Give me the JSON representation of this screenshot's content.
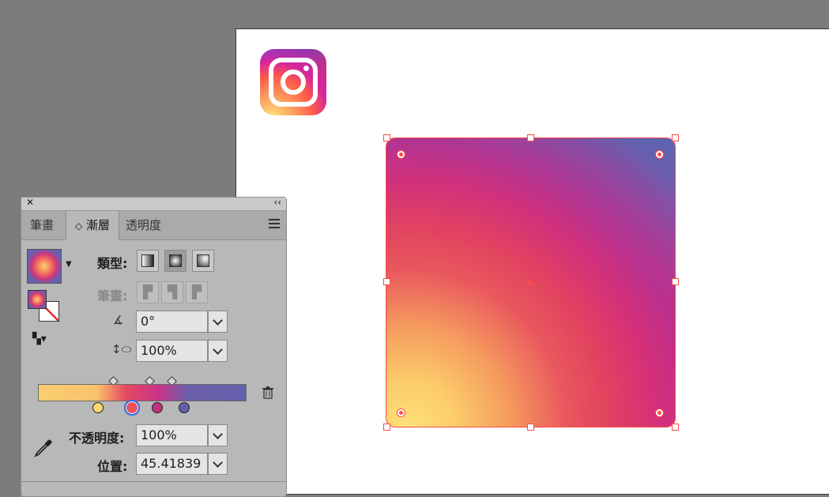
{
  "colors": {
    "selection": "#ff4a4a",
    "accent": "#2d6ae6"
  },
  "canvas": {
    "logo_icon": "instagram-icon"
  },
  "panel": {
    "close_label": "✕",
    "collapse_label": "‹‹",
    "tabs": [
      {
        "label": "筆畫",
        "active": false
      },
      {
        "label": "漸層",
        "active": true,
        "prefix": "◇"
      },
      {
        "label": "透明度",
        "active": false
      }
    ],
    "type_label": "類型:",
    "stroke_label": "筆畫:",
    "angle_value": "0°",
    "aspect_value": "100%",
    "opacity_label": "不透明度:",
    "opacity_value": "100%",
    "position_label": "位置:",
    "position_value": "45.41839",
    "gradient_stops": [
      {
        "color": "#fcd66f",
        "selected": false
      },
      {
        "color": "#e8525c",
        "selected": true
      },
      {
        "color": "#c2307f",
        "selected": false
      },
      {
        "color": "#6260aa",
        "selected": false
      }
    ]
  }
}
